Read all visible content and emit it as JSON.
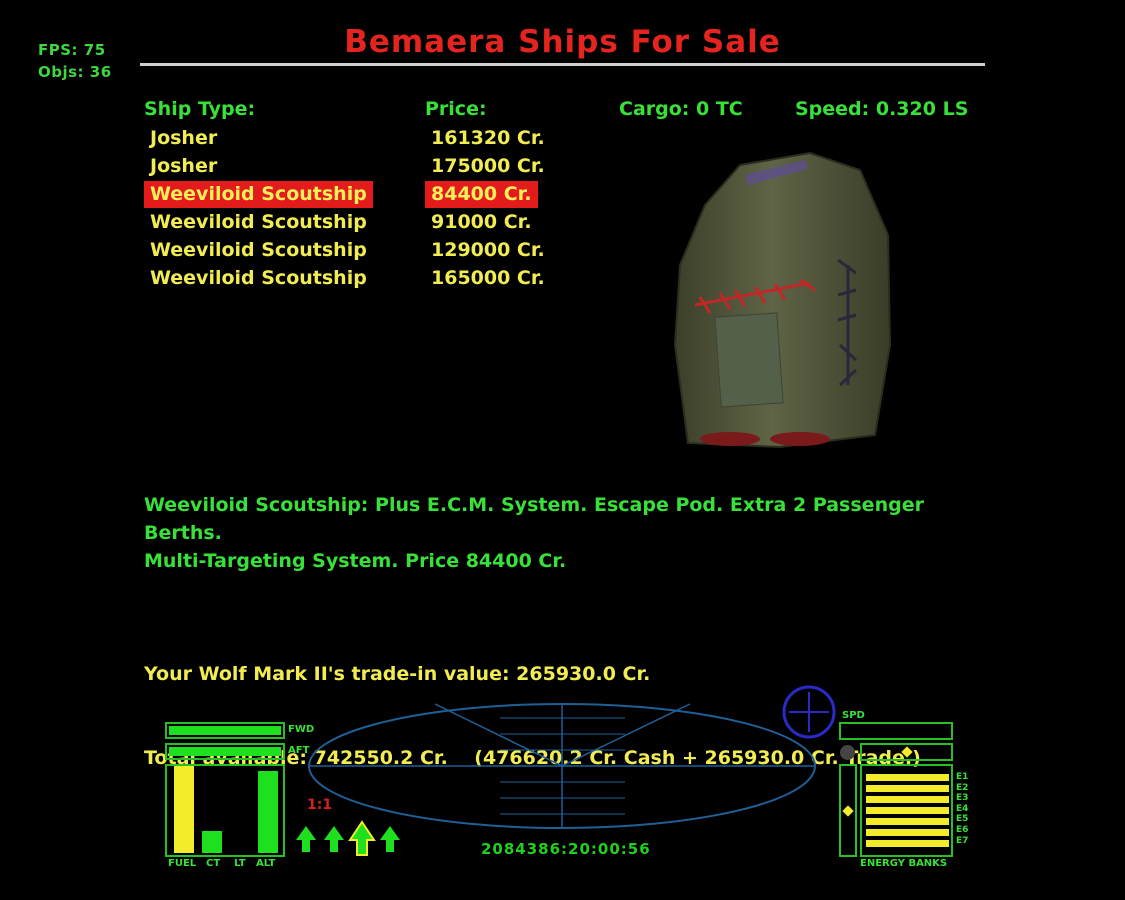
{
  "hud_stats": {
    "fps": "FPS:  75",
    "objs": "Objs:  36"
  },
  "screen_title": "Bemaera Ships For Sale",
  "columns": {
    "ship_type": "Ship Type:",
    "price": "Price:",
    "cargo": "Cargo: 0 TC",
    "speed": "Speed: 0.320 LS"
  },
  "ships": [
    {
      "name": "Josher",
      "price": "161320 Cr.",
      "selected": false
    },
    {
      "name": "Josher",
      "price": "175000 Cr.",
      "selected": false
    },
    {
      "name": "Weeviloid Scoutship",
      "price": "84400 Cr.",
      "selected": true
    },
    {
      "name": "Weeviloid Scoutship",
      "price": "91000 Cr.",
      "selected": false
    },
    {
      "name": "Weeviloid Scoutship",
      "price": "129000 Cr.",
      "selected": false
    },
    {
      "name": "Weeviloid Scoutship",
      "price": "165000 Cr.",
      "selected": false
    }
  ],
  "description": {
    "line1": "Weeviloid Scoutship: Plus E.C.M. System. Escape Pod. Extra 2 Passenger Berths.",
    "line2": "Multi-Targeting System. Price 84400 Cr."
  },
  "trade": {
    "line1": "Your Wolf Mark II's trade-in value: 265930.0 Cr.",
    "line2": "Total available: 742550.2 Cr.    (476620.2 Cr. Cash + 265930.0 Cr. Trade.)"
  },
  "dashboard": {
    "shield_labels": {
      "fwd": "FWD",
      "aft": "AFT"
    },
    "gauge_labels": [
      "FUEL",
      "CT",
      "LT",
      "ALT"
    ],
    "gauge_levels": {
      "fuel": 1.0,
      "ct": 0.25,
      "lt": 0.0,
      "alt": 0.94
    },
    "zoom": "1:1",
    "clock": "2084386:20:00:56",
    "speed_label": "SPD",
    "energy_label": "ENERGY BANKS",
    "energy_banks": [
      "E1",
      "E2",
      "E3",
      "E4",
      "E5",
      "E6",
      "E7"
    ],
    "energy_levels": [
      1,
      1,
      1,
      1,
      1,
      1,
      1
    ],
    "colors": {
      "hud_green": "#26c026",
      "gauge_yellow": "#f2ec2a",
      "scanner_blue": "#1f5f96",
      "compass_blue": "#2a2ac8"
    }
  }
}
